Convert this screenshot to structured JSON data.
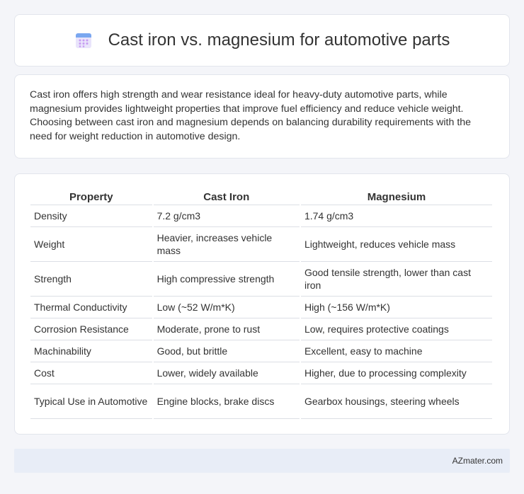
{
  "header": {
    "title": "Cast iron vs. magnesium for automotive parts",
    "icon": "calendar-icon",
    "icon_colors": {
      "top": "#7aa7f0",
      "body": "#e9e4fb",
      "dots": "#c79cf2"
    }
  },
  "intro": {
    "text": "Cast iron offers high strength and wear resistance ideal for heavy-duty automotive parts, while magnesium provides lightweight properties that improve fuel efficiency and reduce vehicle weight. Choosing between cast iron and magnesium depends on balancing durability requirements with the need for weight reduction in automotive design."
  },
  "table": {
    "headers": [
      "Property",
      "Cast Iron",
      "Magnesium"
    ],
    "rows": [
      [
        "Density",
        "7.2 g/cm3",
        "1.74 g/cm3"
      ],
      [
        "Weight",
        "Heavier, increases vehicle mass",
        "Lightweight, reduces vehicle mass"
      ],
      [
        "Strength",
        "High compressive strength",
        "Good tensile strength, lower than cast iron"
      ],
      [
        "Thermal Conductivity",
        "Low (~52 W/m*K)",
        "High (~156 W/m*K)"
      ],
      [
        "Corrosion Resistance",
        "Moderate, prone to rust",
        "Low, requires protective coatings"
      ],
      [
        "Machinability",
        "Good, but brittle",
        "Excellent, easy to machine"
      ],
      [
        "Cost",
        "Lower, widely available",
        "Higher, due to processing complexity"
      ],
      [
        "Typical Use in Automotive",
        "Engine blocks, brake discs",
        "Gearbox housings, steering wheels"
      ]
    ]
  },
  "footer": {
    "text": "AZmater.com"
  }
}
